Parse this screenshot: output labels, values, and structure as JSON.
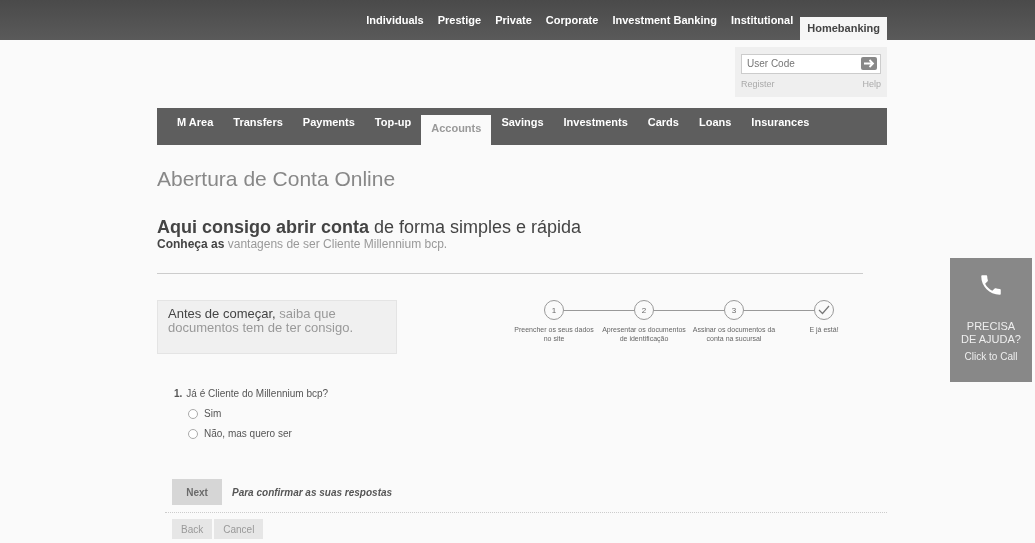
{
  "top_tabs": [
    {
      "label": "Individuals",
      "selected": false
    },
    {
      "label": "Prestige",
      "selected": false
    },
    {
      "label": "Private",
      "selected": false
    },
    {
      "label": "Corporate",
      "selected": false
    },
    {
      "label": "Investment Banking",
      "selected": false
    },
    {
      "label": "Institutional",
      "selected": false
    },
    {
      "label": "Homebanking",
      "selected": true
    }
  ],
  "login": {
    "placeholder": "User Code",
    "register": "Register",
    "help": "Help"
  },
  "nav": [
    {
      "label": "M Area",
      "selected": false
    },
    {
      "label": "Transfers",
      "selected": false
    },
    {
      "label": "Payments",
      "selected": false
    },
    {
      "label": "Top-up",
      "selected": false
    },
    {
      "label": "Accounts",
      "selected": true
    },
    {
      "label": "Savings",
      "selected": false
    },
    {
      "label": "Investments",
      "selected": false
    },
    {
      "label": "Cards",
      "selected": false
    },
    {
      "label": "Loans",
      "selected": false
    },
    {
      "label": "Insurances",
      "selected": false
    }
  ],
  "title": "Abertura de Conta Online",
  "headline": "**Aqui consigo abrir conta** de forma simples e rápida",
  "subtitle": {
    "lead": "Conheça as",
    "link": "vantagens de ser Cliente Millennium bcp."
  },
  "info": {
    "lead": "Antes de começar,",
    "rest": "saiba que documentos tem de ter consigo."
  },
  "steps": [
    {
      "kind": "number",
      "mark": "1",
      "label": "Preencher os seus dados no site"
    },
    {
      "kind": "number",
      "mark": "2",
      "label": "Apresentar os documentos de identificação"
    },
    {
      "kind": "number",
      "mark": "3",
      "label": "Assinar os documentos da conta na sucursal"
    },
    {
      "kind": "check",
      "label": "E já está!"
    }
  ],
  "question": {
    "number": "1.",
    "text": "Já é Cliente do Millennium bcp?",
    "options": [
      {
        "label": "Sim",
        "selected": false
      },
      {
        "label": "Não, mas quero ser",
        "selected": false
      }
    ]
  },
  "next": {
    "label": "Next",
    "disabled": true,
    "hint": "Para confirmar as suas respostas"
  },
  "footer_buttons": [
    "Back",
    "Cancel"
  ],
  "help_widget": {
    "title": "PRECISA DE AJUDA?",
    "action": "Click to Call"
  }
}
